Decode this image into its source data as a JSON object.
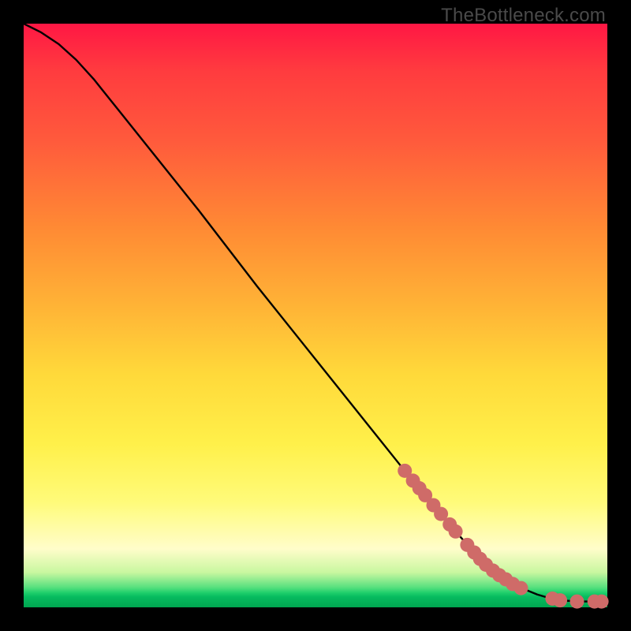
{
  "watermark": "TheBottleneck.com",
  "colors": {
    "background": "#000000",
    "gradient_top": "#ff1744",
    "gradient_mid": "#ffd93a",
    "gradient_bottom": "#00a650",
    "curve_stroke": "#000000",
    "marker_fill": "#cf6b68",
    "marker_stroke": "#cf6b68"
  },
  "chart_data": {
    "type": "line",
    "title": "",
    "xlabel": "",
    "ylabel": "",
    "xlim": [
      0,
      100
    ],
    "ylim": [
      0,
      100
    ],
    "legend": null,
    "grid": false,
    "series": [
      {
        "name": "curve",
        "x": [
          0.0,
          3.0,
          6.0,
          9.0,
          12.0,
          16.0,
          22.0,
          30.0,
          40.0,
          50.0,
          60.0,
          68.0,
          74.0,
          78.0,
          82.0,
          86.0,
          88.0,
          90.0,
          92.0,
          95.0,
          100.0
        ],
        "y": [
          100.0,
          98.5,
          96.5,
          93.8,
          90.5,
          85.5,
          78.0,
          68.0,
          55.0,
          42.5,
          30.0,
          20.0,
          13.0,
          8.5,
          5.2,
          3.0,
          2.2,
          1.6,
          1.2,
          1.0,
          1.0
        ]
      }
    ],
    "markers": [
      {
        "x": 65.3,
        "y": 23.4
      },
      {
        "x": 66.7,
        "y": 21.7
      },
      {
        "x": 67.8,
        "y": 20.4
      },
      {
        "x": 68.8,
        "y": 19.2
      },
      {
        "x": 70.2,
        "y": 17.5
      },
      {
        "x": 71.5,
        "y": 16.0
      },
      {
        "x": 73.0,
        "y": 14.2
      },
      {
        "x": 74.0,
        "y": 13.0
      },
      {
        "x": 76.0,
        "y": 10.7
      },
      {
        "x": 77.2,
        "y": 9.4
      },
      {
        "x": 78.2,
        "y": 8.3
      },
      {
        "x": 79.2,
        "y": 7.3
      },
      {
        "x": 80.4,
        "y": 6.3
      },
      {
        "x": 81.5,
        "y": 5.5
      },
      {
        "x": 82.6,
        "y": 4.8
      },
      {
        "x": 83.8,
        "y": 4.0
      },
      {
        "x": 85.2,
        "y": 3.3
      },
      {
        "x": 90.6,
        "y": 1.5
      },
      {
        "x": 91.9,
        "y": 1.2
      },
      {
        "x": 94.8,
        "y": 1.0
      },
      {
        "x": 97.8,
        "y": 1.0
      },
      {
        "x": 99.0,
        "y": 1.0
      }
    ]
  }
}
